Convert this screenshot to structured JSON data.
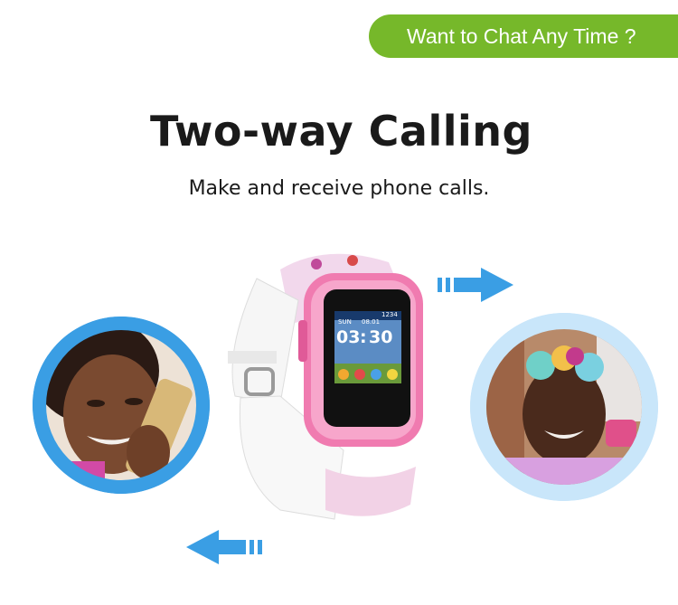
{
  "banner": {
    "text": "Want to Chat Any Time ?"
  },
  "headline": "Two-way Calling",
  "subheadline": "Make and receive phone calls.",
  "watch_screen": {
    "day": "SUN",
    "date": "08.01",
    "hours": "03",
    "minutes": "30",
    "number": "1234"
  },
  "colors": {
    "banner_green": "#76b82a",
    "circle_blue": "#3a9ee4",
    "circle_light_blue": "#c9e6fa",
    "arrow_blue": "#3a9ee4",
    "watch_pink": "#f07bb0"
  },
  "icons": {
    "arrow_right": "arrow-right-icon",
    "arrow_left": "arrow-left-icon"
  }
}
